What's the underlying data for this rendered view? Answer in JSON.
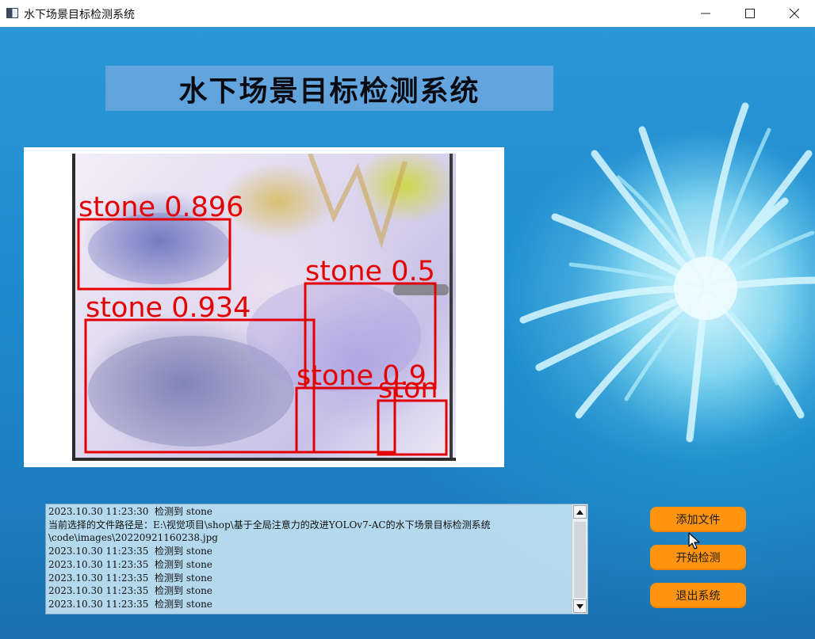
{
  "window": {
    "title": "水下场景目标检测系统",
    "controls": [
      "minimize",
      "maximize",
      "close"
    ]
  },
  "banner": {
    "title": "水下场景目标检测系统"
  },
  "detections": [
    {
      "label": "stone 0.896"
    },
    {
      "label": "stone 0.934"
    },
    {
      "label": "stone 0.5"
    },
    {
      "label": "stone 0.9"
    },
    {
      "label": "ston"
    }
  ],
  "log": {
    "lines": [
      "2023.10.30 11:23:30  检测到 stone",
      "当前选择的文件路径是：E:\\视觉项目\\shop\\基于全局注意力的改进YOLOv7-AC的水下场景目标检测系统",
      "\\code\\images\\20220921160238.jpg",
      "2023.10.30 11:23:35  检测到 stone",
      "2023.10.30 11:23:35  检测到 stone",
      "2023.10.30 11:23:35  检测到 stone",
      "2023.10.30 11:23:35  检测到 stone",
      "2023.10.30 11:23:35  检测到 stone"
    ]
  },
  "buttons": {
    "add_file": "添加文件",
    "start_detect": "开始检测",
    "exit_system": "退出系统"
  },
  "colors": {
    "button_bg": "#ff9410",
    "detection_box": "#e40000",
    "banner_bg": "#78aae1"
  }
}
